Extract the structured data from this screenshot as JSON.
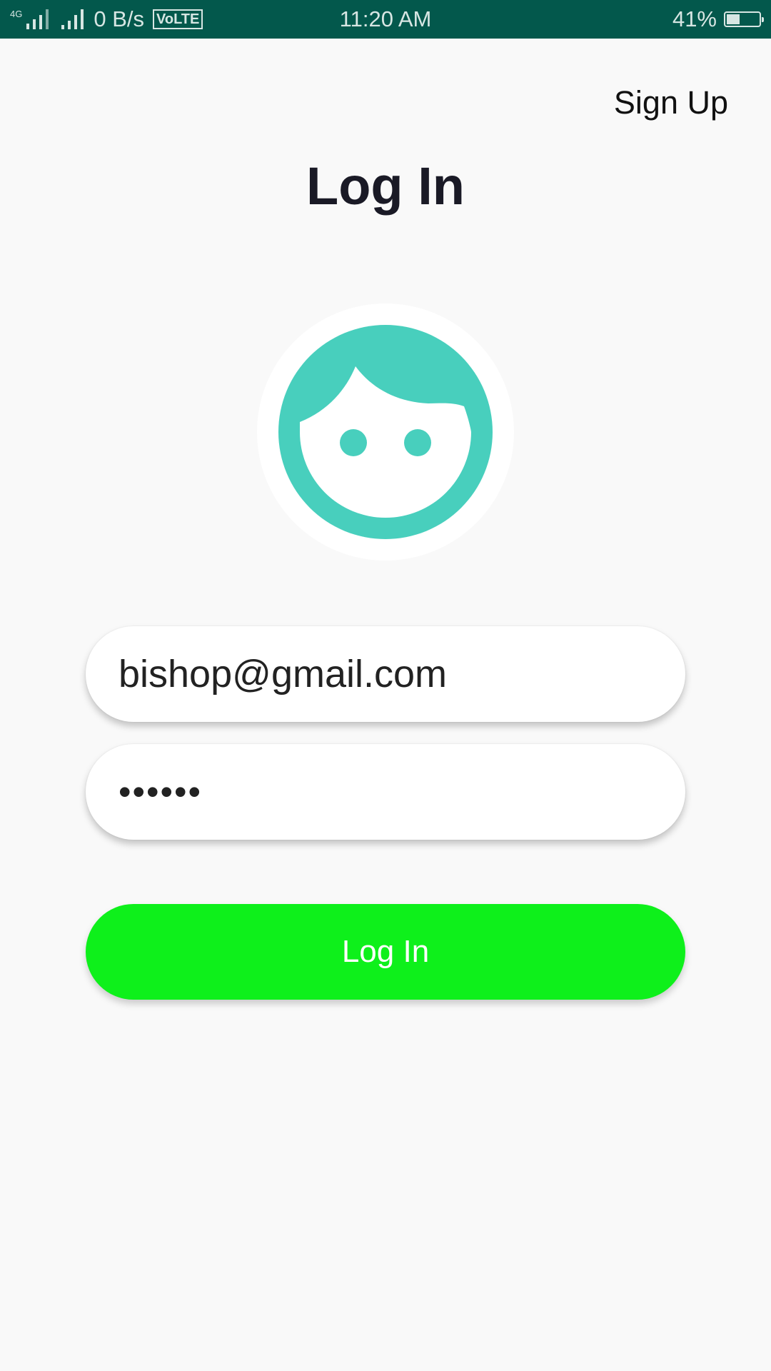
{
  "status_bar": {
    "network_type": "4G",
    "data_rate": "0 B/s",
    "volte": "VoLTE",
    "time": "11:20 AM",
    "battery_percent": "41%",
    "battery_level": 0.41
  },
  "header": {
    "signup_label": "Sign Up",
    "title": "Log In"
  },
  "form": {
    "email_value": "bishop@gmail.com",
    "password_value": "••••••",
    "login_label": "Log In"
  },
  "colors": {
    "status_bar": "#03584c",
    "avatar_accent": "#48cfbd",
    "login_button": "#0ef01b",
    "background": "#f9f9f9"
  },
  "icons": {
    "avatar": "face-icon",
    "battery": "battery-icon",
    "signal": "signal-icon"
  }
}
